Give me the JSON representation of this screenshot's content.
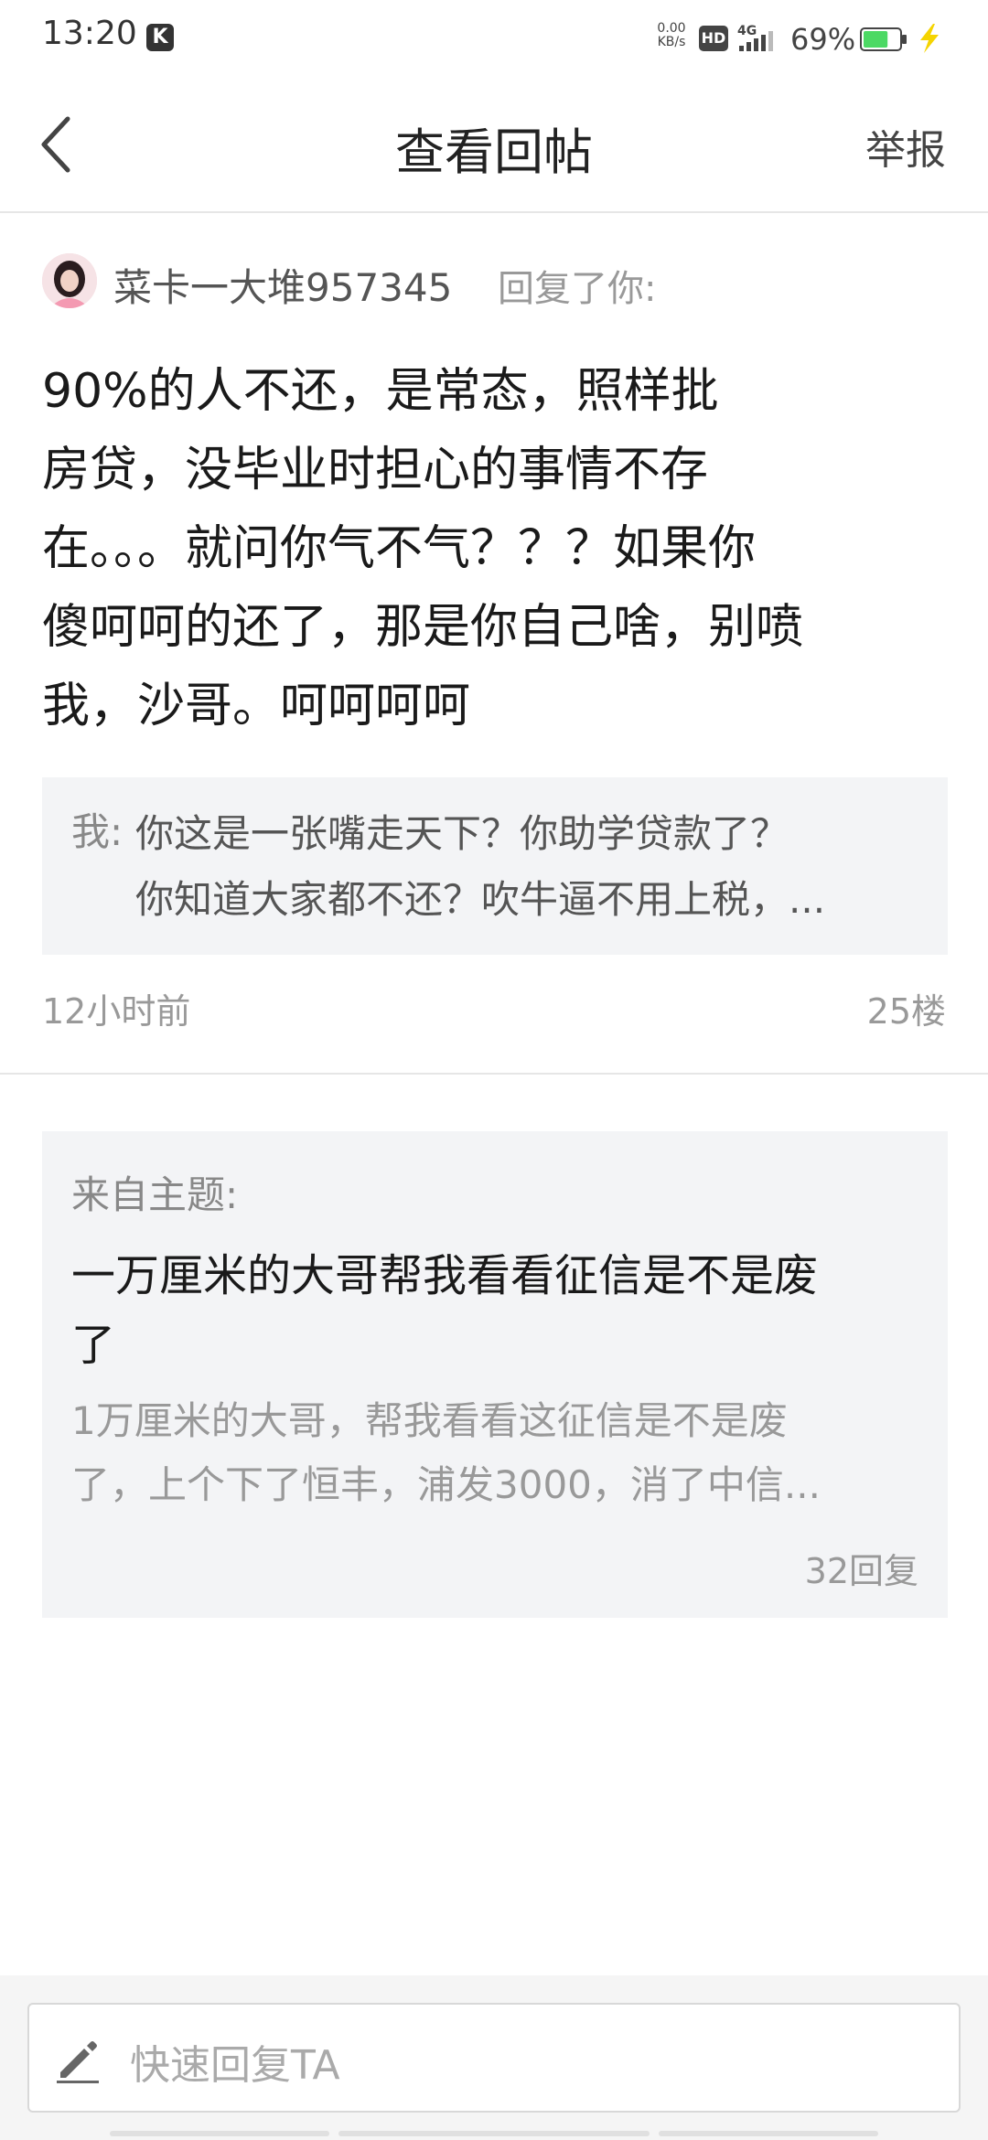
{
  "status_bar": {
    "time": "13:20",
    "speed_value": "0.00",
    "speed_unit": "KB/s",
    "hd": "HD",
    "network": "4G",
    "battery": "69%",
    "battery_level": 0.69,
    "battery_color": "#4cd964",
    "charge_color": "#f5d400"
  },
  "header": {
    "title": "查看回帖",
    "report_label": "举报"
  },
  "reply": {
    "username": "菜卡一大堆957345",
    "reply_tag": "回复了你:",
    "content": "90%的人不还，是常态，照样批房贷，没毕业时担心的事情不存在。。。就问你气不气？？？如果你傻呵呵的还了，那是你自己啥，别喷我，沙哥。呵呵呵呵",
    "content_lines": [
      "90%的人不还，是常态，照样批",
      "房贷，没毕业时担心的事情不存",
      "在。。。就问你气不气？？？如果你",
      "傻呵呵的还了，那是你自己啥，别喷",
      "我，沙哥。呵呵呵呵"
    ],
    "quote_prefix": "我:",
    "quote_lines": [
      "你这是一张嘴走天下？你助学贷款了？",
      "你知道大家都不还？吹牛逼不用上税，..."
    ],
    "time_ago": "12小时前",
    "floor": "25楼"
  },
  "topic": {
    "from_label": "来自主题:",
    "title_lines": [
      "一万厘米的大哥帮我看看征信是不是废",
      "了"
    ],
    "excerpt_lines": [
      "1万厘米的大哥，帮我看看这征信是不是废",
      "了，上个下了恒丰，浦发3000，消了中信..."
    ],
    "reply_count": "32回复"
  },
  "bottom_bar": {
    "input_placeholder": "快速回复TA"
  }
}
